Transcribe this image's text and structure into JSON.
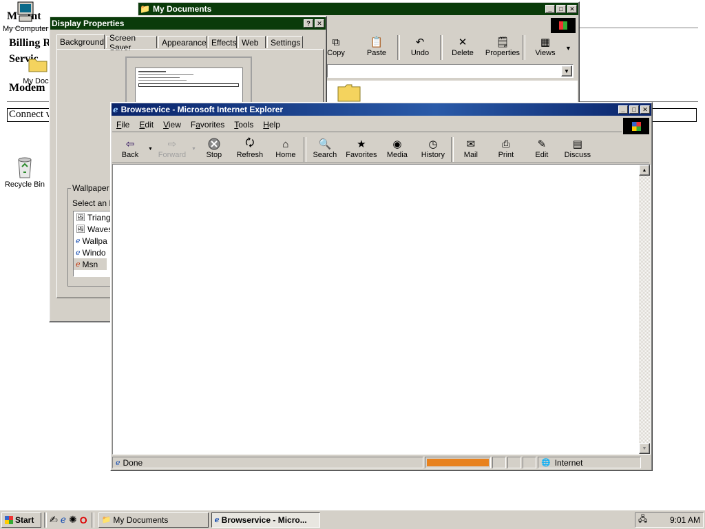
{
  "background_page": {
    "title_fragment": "M",
    "title_fragment2": "Int",
    "billing": "Billing R",
    "service": "Servic",
    "modem": "Modem ",
    "connect_value": "Connect v"
  },
  "desktop_icons": [
    {
      "label": "My Computer"
    },
    {
      "label": "My Docu"
    },
    {
      "label": "Recycle Bin"
    }
  ],
  "my_documents": {
    "title": "My Documents",
    "toolbar": [
      "Copy",
      "Paste",
      "Undo",
      "Delete",
      "Properties",
      "Views"
    ]
  },
  "display_properties": {
    "title": "Display Properties",
    "tabs": [
      "Background",
      "Screen Saver",
      "Appearance",
      "Effects",
      "Web",
      "Settings"
    ],
    "wallpaper_group": "Wallpaper",
    "select_label": "Select an H",
    "list_items": [
      "Triangl",
      "Waves",
      "Wallpa",
      "Windo",
      "Msn"
    ]
  },
  "ie": {
    "title": "Browservice - Microsoft Internet Explorer",
    "menu": [
      "File",
      "Edit",
      "View",
      "Favorites",
      "Tools",
      "Help"
    ],
    "toolbar": [
      {
        "label": "Back",
        "icon": "back-arrow-icon"
      },
      {
        "label": "Forward",
        "icon": "forward-arrow-icon"
      },
      {
        "label": "Stop",
        "icon": "stop-icon"
      },
      {
        "label": "Refresh",
        "icon": "refresh-icon"
      },
      {
        "label": "Home",
        "icon": "home-icon"
      },
      {
        "label": "Search",
        "icon": "search-icon"
      },
      {
        "label": "Favorites",
        "icon": "favorites-icon"
      },
      {
        "label": "Media",
        "icon": "media-icon"
      },
      {
        "label": "History",
        "icon": "history-icon"
      },
      {
        "label": "Mail",
        "icon": "mail-icon"
      },
      {
        "label": "Print",
        "icon": "print-icon"
      },
      {
        "label": "Edit",
        "icon": "edit-icon"
      },
      {
        "label": "Discuss",
        "icon": "discuss-icon"
      }
    ],
    "status_text": "Done",
    "zone": "Internet",
    "progress_color": "#e8821e"
  },
  "taskbar": {
    "start": "Start",
    "tasks": [
      "My Documents",
      "Browservice - Micro..."
    ],
    "clock": "9:01 AM"
  },
  "colors": {
    "face": "#d4d0c8",
    "active_title": "#0a246a",
    "inactive_title": "#808080",
    "folder": "#f4d35e"
  }
}
